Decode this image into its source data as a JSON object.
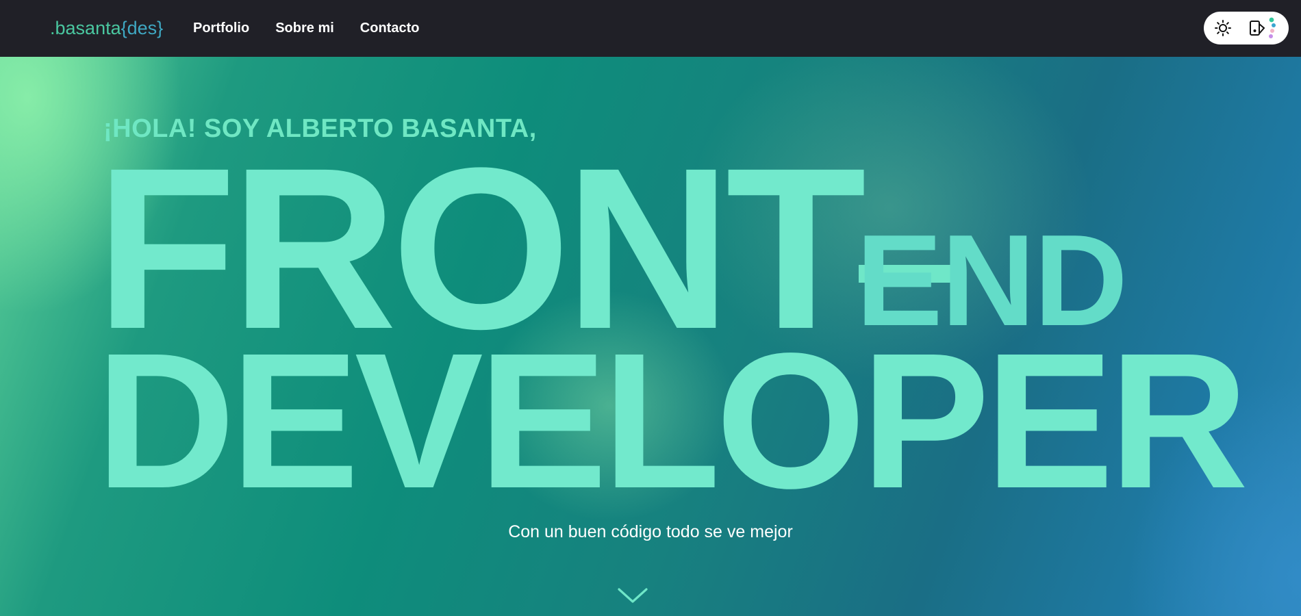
{
  "header": {
    "logo": {
      "dot": ".",
      "name": "basanta",
      "braces": "{des}"
    },
    "nav": [
      "Portfolio",
      "Sobre mi",
      "Contacto"
    ],
    "theme_toggle": {
      "sun_icon": "sun-icon",
      "palette_icon": "palette-icon"
    }
  },
  "hero": {
    "intro": "¡HOLA! SOY ALBERTO BASANTA,",
    "line1": "FRONT",
    "line1_suffix": "END",
    "line2": "DEVELOPER",
    "subtitle": "Con un buen código todo se ve mejor",
    "scroll_icon": "chevron-down-icon"
  },
  "colors": {
    "header_bg": "#202027",
    "accent_green": "#72e9cc",
    "accent_blue": "#3fa8c3",
    "hero_gradient_start": "#5fd39a",
    "hero_gradient_end": "#2b86b7"
  }
}
